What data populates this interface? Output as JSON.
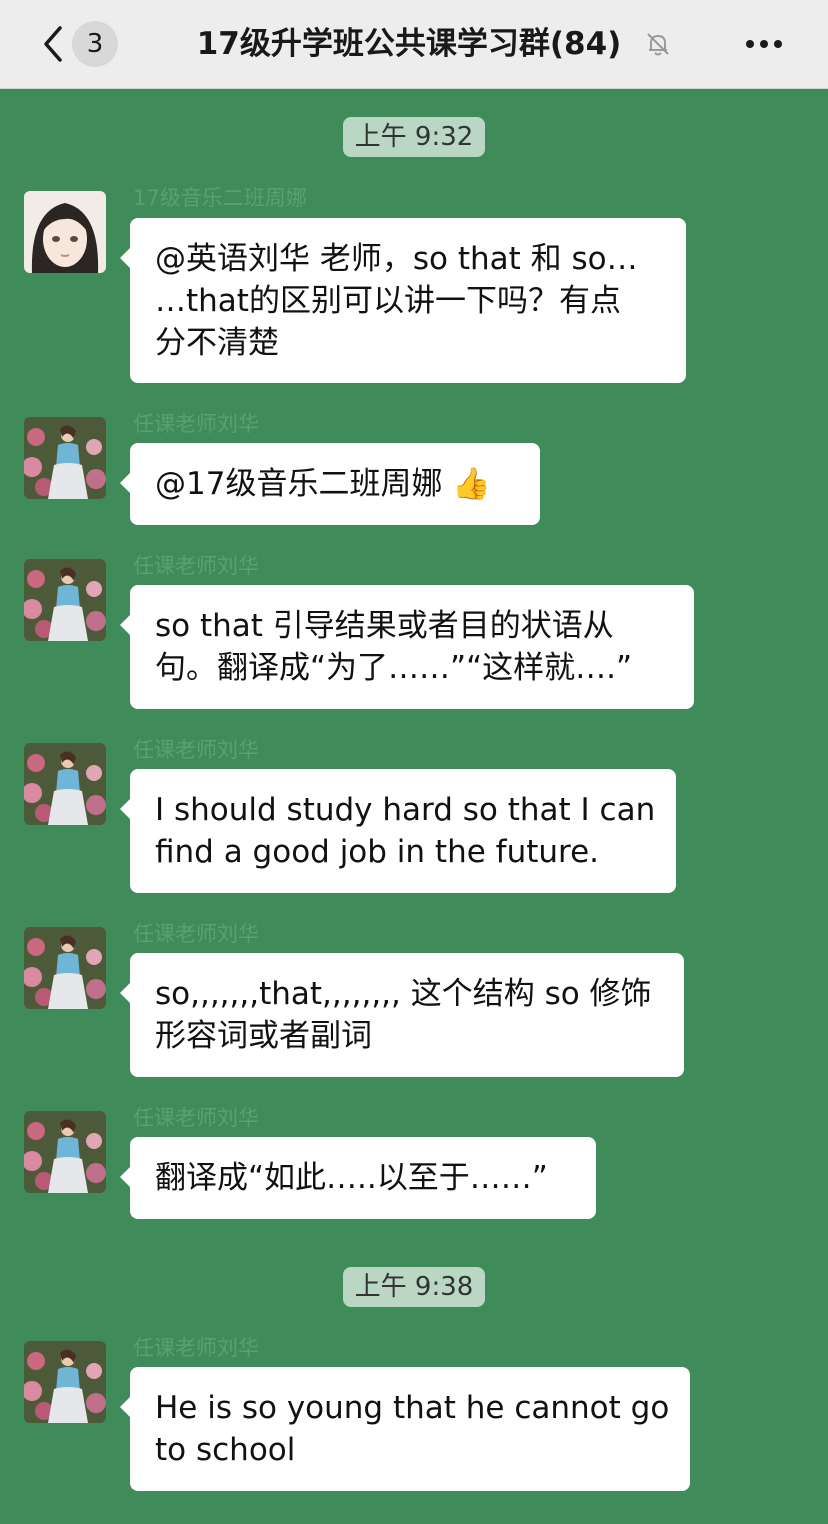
{
  "header": {
    "back_icon": "chevron-left-icon",
    "unread_badge": "3",
    "title": "17级升学班公共课学习群(84)",
    "mute_icon": "bell-off-icon",
    "more_icon": "more-dots-icon"
  },
  "timestamps": [
    "上午 9:32",
    "上午 9:38"
  ],
  "messages": [
    {
      "sender": "17级音乐二班周娜",
      "lines": [
        "@英语刘华 老师，so that 和 so…",
        "…that的区别可以讲一下吗？有点",
        "分不清楚"
      ]
    },
    {
      "sender": "任课老师刘华",
      "lines": [
        "@17级音乐二班周娜"
      ],
      "emoji": "👍"
    },
    {
      "sender": "任课老师刘华",
      "lines": [
        "so that 引导结果或者目的状语从",
        "句。翻译成“为了……”“这样就….”"
      ]
    },
    {
      "sender": "任课老师刘华",
      "lines": [
        "I should study hard so that I can",
        "find a good job in the future."
      ]
    },
    {
      "sender": "任课老师刘华",
      "lines": [
        "so,,,,,,,that,,,,,,,,  这个结构 so 修饰",
        "形容词或者副词"
      ]
    },
    {
      "sender": "任课老师刘华",
      "lines": [
        "翻译成“如此…..以至于……”"
      ]
    },
    {
      "sender": "任课老师刘华",
      "lines": [
        "He is so young that he cannot go",
        "to school"
      ]
    }
  ]
}
